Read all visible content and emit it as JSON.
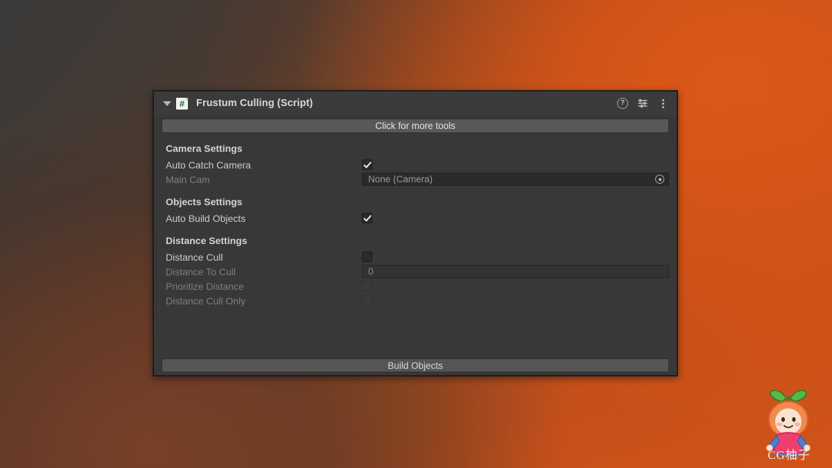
{
  "window": {
    "component_title": "Frustum Culling (Script)",
    "script_icon_glyph": "#"
  },
  "header_icons": {
    "help": "?",
    "help_name": "help-icon",
    "preset_name": "preset-icon",
    "menu_name": "more-menu-icon"
  },
  "toolbar": {
    "more_tools_label": "Click for more tools"
  },
  "sections": {
    "camera": {
      "title": "Camera Settings",
      "auto_catch_camera": {
        "label": "Auto Catch Camera",
        "checked": true,
        "disabled": false
      },
      "main_cam": {
        "label": "Main Cam",
        "value": "None (Camera)",
        "disabled": true
      }
    },
    "objects": {
      "title": "Objects Settings",
      "auto_build_objects": {
        "label": "Auto Build Objects",
        "checked": true,
        "disabled": false
      }
    },
    "distance": {
      "title": "Distance Settings",
      "distance_cull": {
        "label": "Distance Cull",
        "checked": false,
        "disabled": false
      },
      "distance_to_cull": {
        "label": "Distance To Cull",
        "value": "0",
        "disabled": true
      },
      "prioritize_distance": {
        "label": "Prioritize Distance",
        "checked": false,
        "disabled": true
      },
      "distance_cull_only": {
        "label": "Distance Cull Only",
        "checked": false,
        "disabled": true
      }
    }
  },
  "footer": {
    "build_objects_label": "Build Objects"
  },
  "watermark": {
    "text": "CG柚子"
  },
  "colors": {
    "panel_bg": "#383838",
    "header_bg": "#3b3b3b",
    "button_bg": "#585858",
    "label": "#cccccc",
    "label_disabled": "#7e7e7e",
    "accent_orange": "#d2541b",
    "script_green": "#1f6b3a"
  }
}
